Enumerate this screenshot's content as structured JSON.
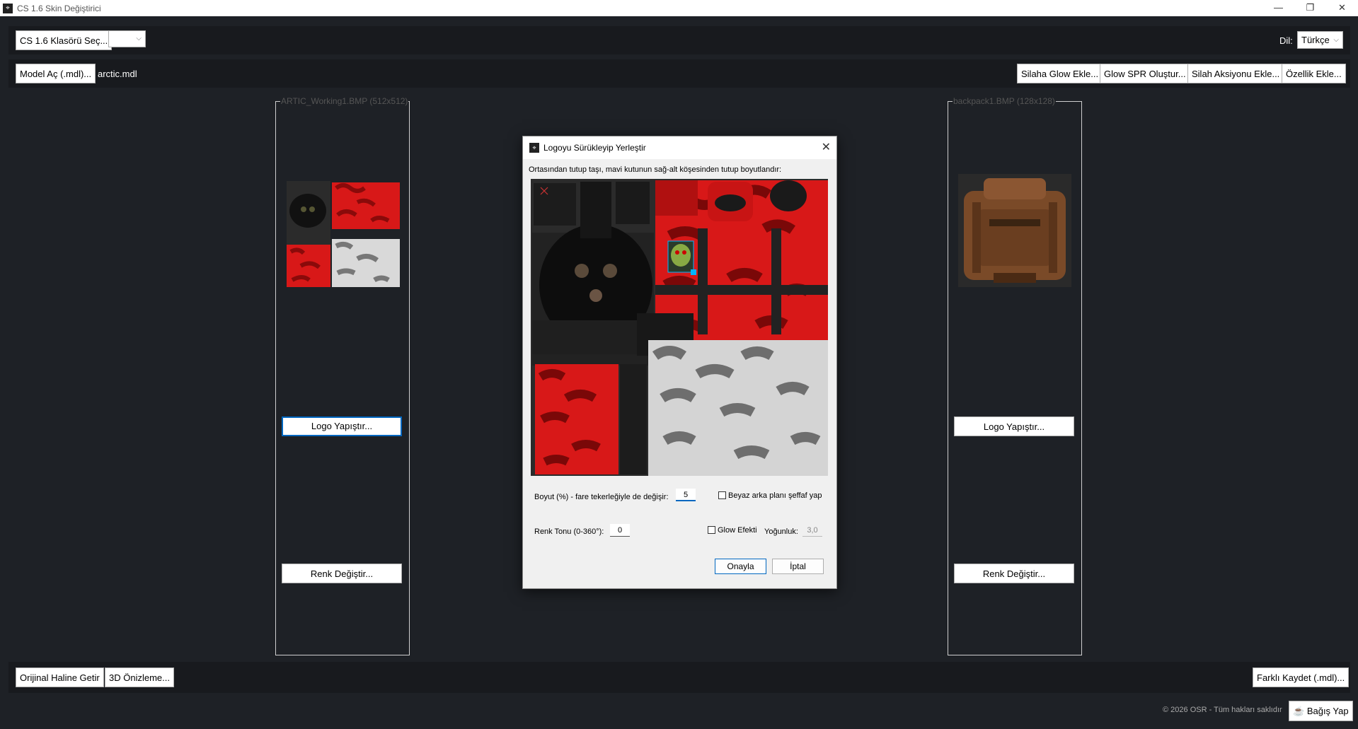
{
  "window": {
    "title": "CS 1.6 Skin Değiştirici",
    "minimize": "—",
    "maximize": "❐",
    "close": "✕"
  },
  "toolbar1": {
    "folder_button": "CS 1.6 Klasörü Seç...",
    "combo_value": "",
    "language_label": "Dil:",
    "language_value": "Türkçe"
  },
  "toolbar2": {
    "open_model_button": "Model Aç (.mdl)...",
    "model_name": "arctic.mdl",
    "glow_button": "Silaha Glow Ekle...",
    "spr_button": "Glow SPR Oluştur...",
    "action_button": "Silah Aksiyonu Ekle...",
    "feature_button": "Özellik Ekle..."
  },
  "left_panel": {
    "title": "ARTIC_Working1.BMP (512x512)",
    "logo_button": "Logo Yapıştır...",
    "color_button": "Renk Değiştir..."
  },
  "right_panel": {
    "title": "backpack1.BMP (128x128)",
    "logo_button": "Logo Yapıştır...",
    "color_button": "Renk Değiştir..."
  },
  "bottom": {
    "restore_button": "Orijinal Haline Getir",
    "preview_button": "3D Önizleme...",
    "save_as_button": "Farklı Kaydet (.mdl)...",
    "copyright": "© 2026 OSR - Tüm hakları saklıdır",
    "donate_button": "Bağış Yap"
  },
  "dialog": {
    "title": "Logoyu Sürükleyip Yerleştir",
    "instructions": "Ortasından tutup taşı, mavi kutunun sağ-alt köşesinden tutup boyutlandır:",
    "size_label": "Boyut (%) - fare tekerleğiyle de değişir:",
    "size_value": "5",
    "white_transparent_label": "Beyaz arka planı şeffaf yap",
    "hue_label": "Renk Tonu (0-360°):",
    "hue_value": "0",
    "glow_label": "Glow Efekti",
    "intensity_label": "Yoğunluk:",
    "intensity_value": "3,0",
    "ok_button": "Onayla",
    "cancel_button": "İptal"
  },
  "colors": {
    "background": "#1e2126",
    "bar": "#181a1e",
    "camo_red": "#e02020",
    "accent": "#0067c0",
    "handle": "#00b4ff"
  }
}
